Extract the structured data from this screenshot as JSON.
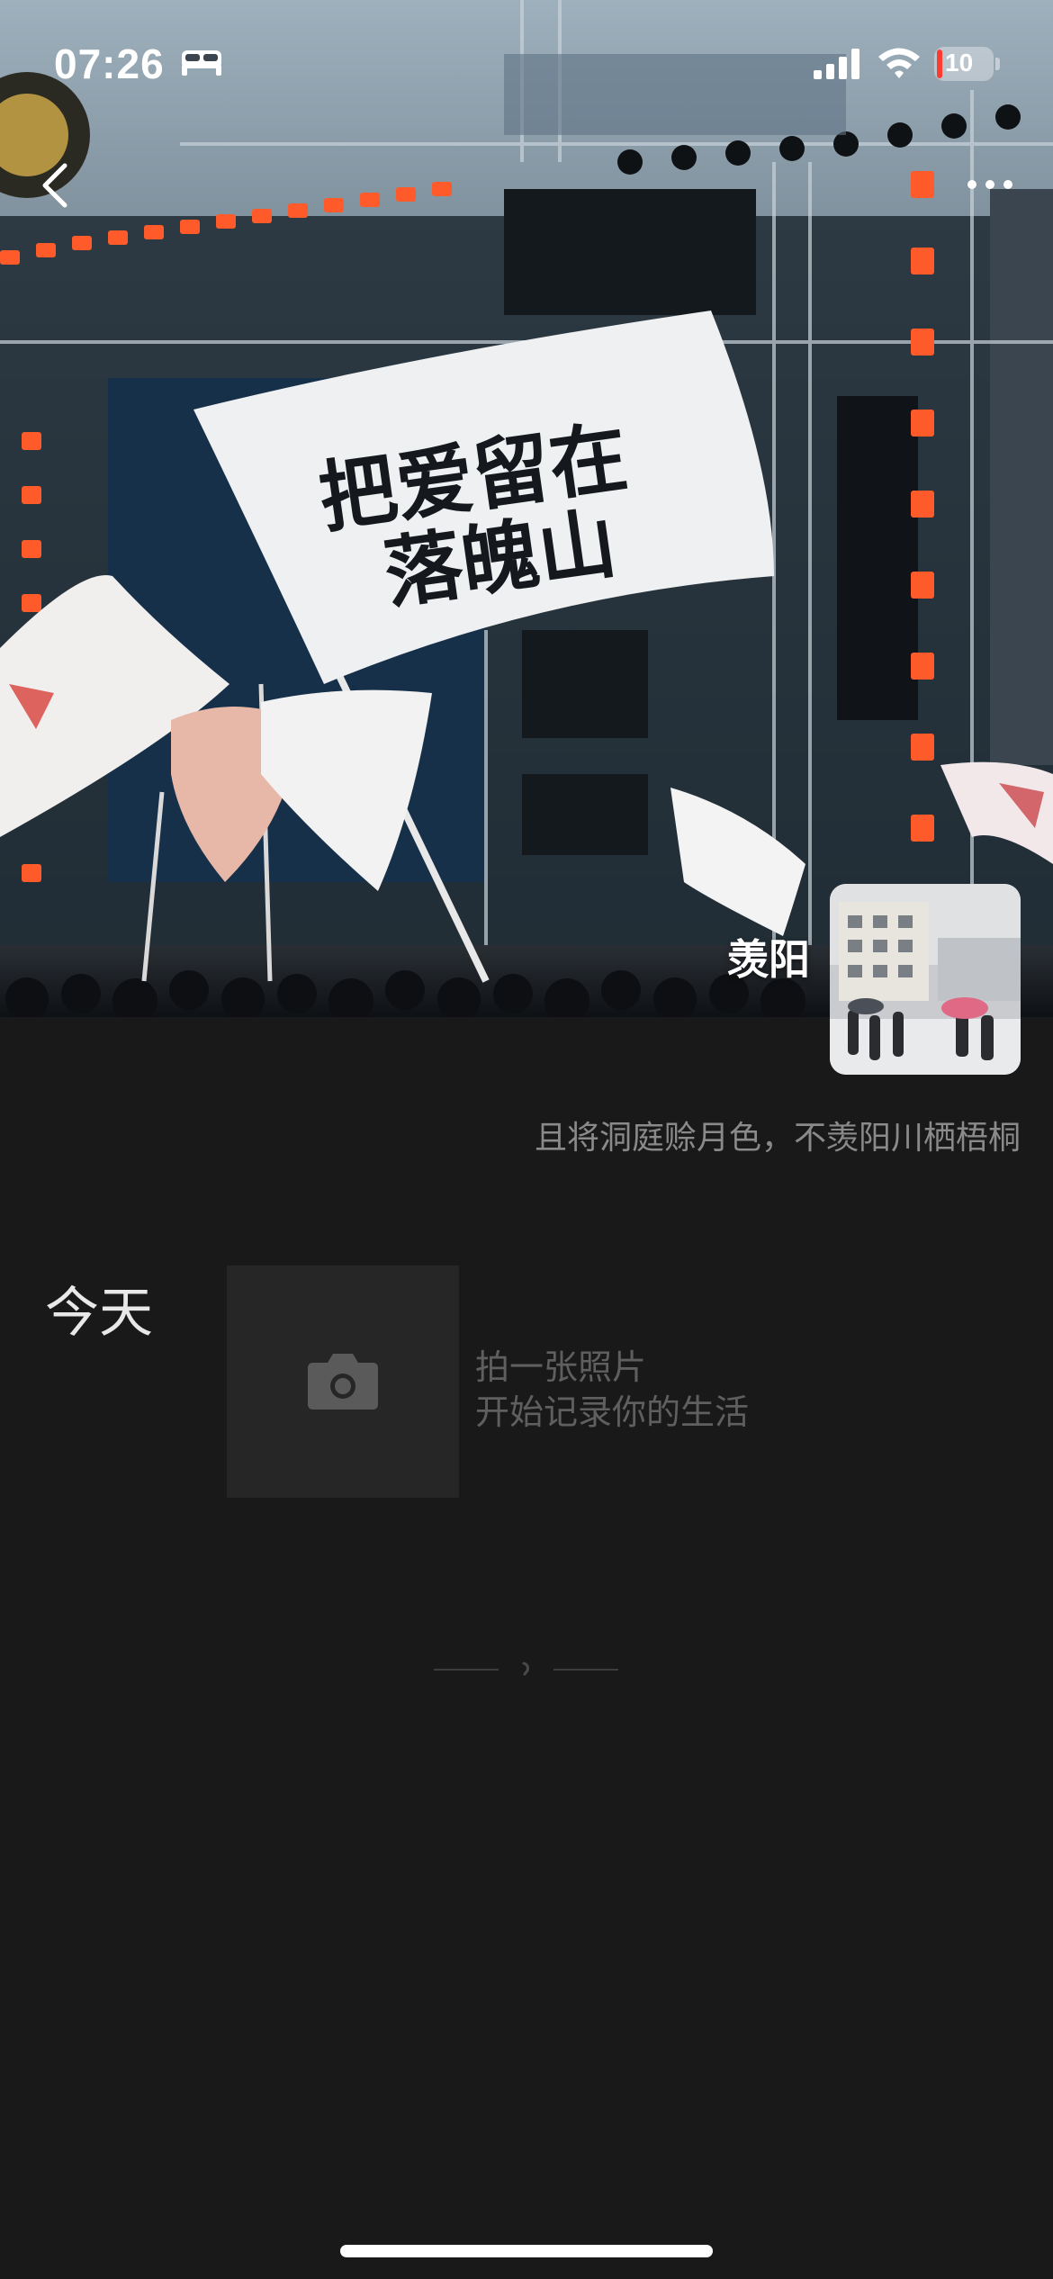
{
  "status_bar": {
    "time": "07:26",
    "battery_level": "10",
    "icons": [
      "bed-icon",
      "signal-icon",
      "wifi-icon",
      "battery-icon"
    ]
  },
  "nav": {
    "back_icon": "chevron-left-icon",
    "more_icon": "more-dots-icon"
  },
  "cover": {
    "flag_text_line1": "把爱留在",
    "flag_text_line2": "落魄山"
  },
  "profile": {
    "name": "羡阳",
    "signature": "且将洞庭赊月色，不羡阳川栖梧桐"
  },
  "feed": {
    "today_label": "今天",
    "camera_icon": "camera-icon",
    "prompt_line1": "拍一张照片",
    "prompt_line2": "开始记录你的生活"
  },
  "colors": {
    "background": "#191919",
    "tile": "#262626",
    "muted_text": "#8a8a8a",
    "prompt_text": "#5f5f5f"
  }
}
